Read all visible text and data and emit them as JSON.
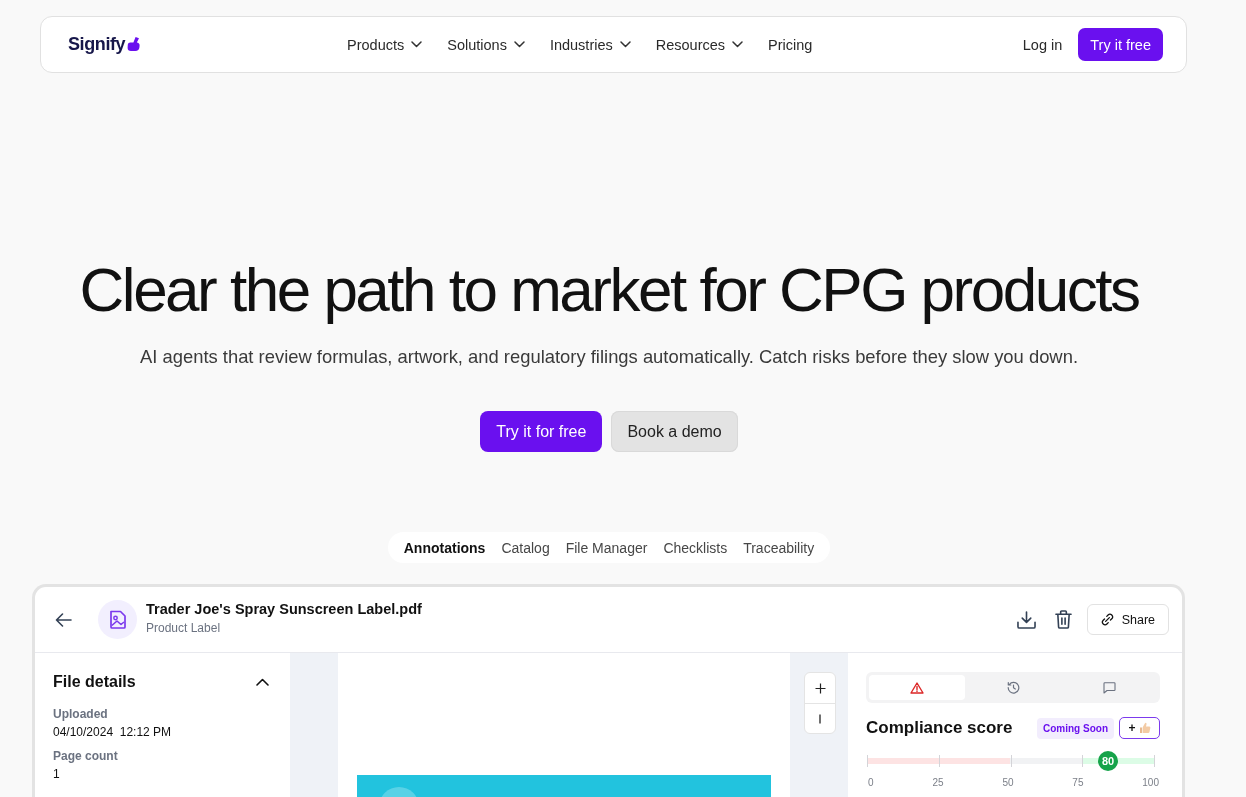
{
  "nav": {
    "logo": "Signify",
    "menu": [
      {
        "label": "Products",
        "has_menu": true
      },
      {
        "label": "Solutions",
        "has_menu": true
      },
      {
        "label": "Industries",
        "has_menu": true
      },
      {
        "label": "Resources",
        "has_menu": true
      },
      {
        "label": "Pricing",
        "has_menu": false
      }
    ],
    "login": "Log in",
    "cta": "Try it free"
  },
  "hero": {
    "title": "Clear the path to market for CPG products",
    "subtitle": "AI agents that review formulas, artwork, and regulatory filings automatically. Catch risks before they slow you down.",
    "buttons": [
      {
        "label": "Try it for free",
        "kind": "primary"
      },
      {
        "label": "Book a demo",
        "kind": "secondary"
      }
    ]
  },
  "product_tabs": [
    {
      "label": "Annotations",
      "selected": true
    },
    {
      "label": "Catalog",
      "selected": false
    },
    {
      "label": "File Manager",
      "selected": false
    },
    {
      "label": "Checklists",
      "selected": false
    },
    {
      "label": "Traceability",
      "selected": false
    }
  ],
  "app": {
    "file": {
      "name": "Trader Joe's Spray Sunscreen Label.pdf",
      "type": "Product Label"
    },
    "share": "Share",
    "details": {
      "title": "File details",
      "expanded": true,
      "fields": [
        {
          "label": "Uploaded",
          "value": "04/10/2024  12:12 PM"
        },
        {
          "label": "Page count",
          "value": "1"
        }
      ]
    },
    "panel_tabs": [
      {
        "kind": "alerts",
        "selected": true
      },
      {
        "kind": "history",
        "selected": false
      },
      {
        "kind": "comments",
        "selected": false
      }
    ],
    "compliance": {
      "title": "Compliance score",
      "badge": "Coming Soon",
      "react_label": "+",
      "score": "80",
      "level": 0.84,
      "ticks": [
        "0",
        "25",
        "50",
        "75",
        "100"
      ]
    }
  }
}
